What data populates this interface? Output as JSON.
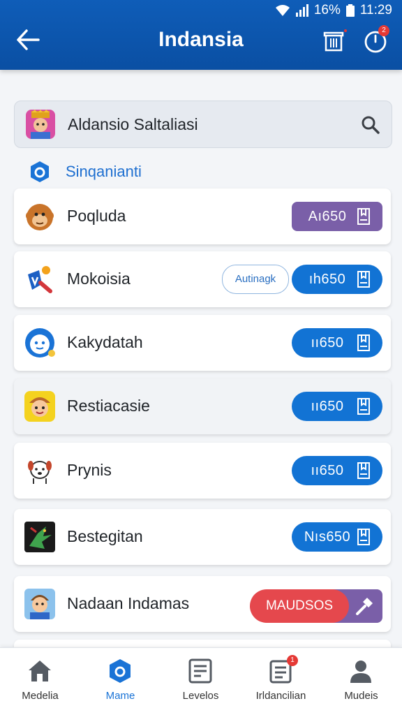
{
  "status": {
    "battery": "16%",
    "time": "11:29"
  },
  "header": {
    "title": "Indansia",
    "notif_badge": "2"
  },
  "search": {
    "text": "Aldansio Saltaliasi"
  },
  "section": {
    "label": "Sinqanianti"
  },
  "items": [
    {
      "name": "Poqluda",
      "button": "Aı650",
      "style": "purple",
      "icon": "monkey-avatar-icon"
    },
    {
      "name": "Mokoisia",
      "button": "ıh650",
      "secondary": "Autinagk",
      "style": "blue",
      "icon": "sword-badge-icon"
    },
    {
      "name": "Kakydatah",
      "button": "ıı650",
      "style": "blue",
      "icon": "blue-face-icon"
    },
    {
      "name": "Restiacasie",
      "button": "ıı650",
      "style": "blue",
      "icon": "explorer-avatar-icon"
    },
    {
      "name": "Prynis",
      "button": "ıı650",
      "style": "blue",
      "icon": "cartoon-dog-icon"
    },
    {
      "name": "Bestegitan",
      "button": "Nıs650",
      "style": "blue",
      "icon": "dragon-icon"
    },
    {
      "name": "Nadaan Indamas",
      "button": "MAUDSOS",
      "style": "red-purple",
      "icon": "boy-avatar-icon"
    }
  ],
  "nav": [
    {
      "label": "Medelia",
      "icon": "home-icon"
    },
    {
      "label": "Mame",
      "icon": "hex-badge-icon",
      "active": true
    },
    {
      "label": "Levelos",
      "icon": "list-document-icon"
    },
    {
      "label": "Irldancilian",
      "icon": "notes-icon",
      "badge": "1"
    },
    {
      "label": "Mudeis",
      "icon": "person-icon"
    }
  ],
  "colors": {
    "primary": "#0f5db8",
    "accent_blue": "#1273d4",
    "purple": "#7a5fa8",
    "red": "#e5484d"
  }
}
